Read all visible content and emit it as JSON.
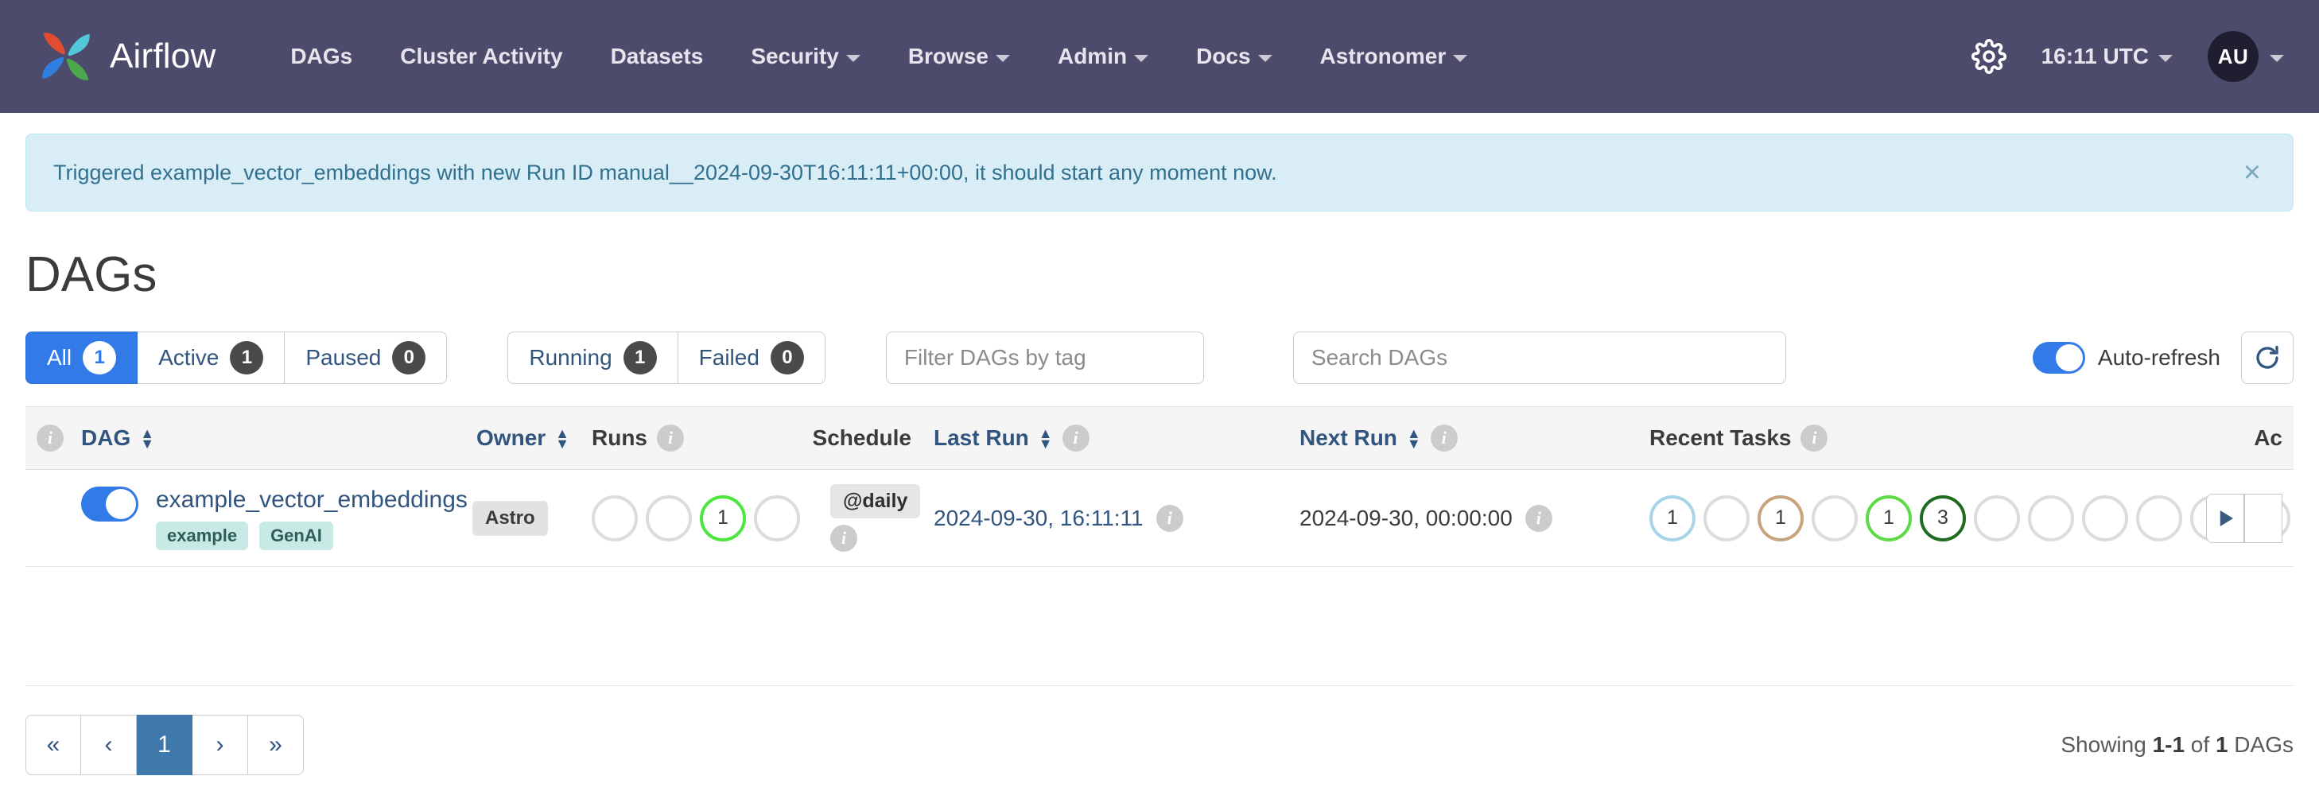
{
  "navbar": {
    "brand": "Airflow",
    "links": [
      {
        "label": "DAGs",
        "caret": false
      },
      {
        "label": "Cluster Activity",
        "caret": false
      },
      {
        "label": "Datasets",
        "caret": false
      },
      {
        "label": "Security",
        "caret": true
      },
      {
        "label": "Browse",
        "caret": true
      },
      {
        "label": "Admin",
        "caret": true
      },
      {
        "label": "Docs",
        "caret": true
      },
      {
        "label": "Astronomer",
        "caret": true
      }
    ],
    "settings_icon": "gear-icon",
    "clock": "16:11 UTC",
    "avatar_initials": "AU",
    "background_color": "#4d4b6c"
  },
  "alert": {
    "message": "Triggered example_vector_embeddings with new Run ID manual__2024-09-30T16:11:11+00:00, it should start any moment now.",
    "close_label": "×",
    "background_color": "#d9edf7",
    "text_color": "#31708f"
  },
  "page": {
    "title": "DAGs"
  },
  "filters": {
    "status_group": [
      {
        "label": "All",
        "count": "1",
        "active": true
      },
      {
        "label": "Active",
        "count": "1",
        "active": false
      },
      {
        "label": "Paused",
        "count": "0",
        "active": false
      }
    ],
    "state_group": [
      {
        "label": "Running",
        "count": "1",
        "active": false
      },
      {
        "label": "Failed",
        "count": "0",
        "active": false
      }
    ],
    "tag_filter_placeholder": "Filter DAGs by tag",
    "tag_filter_value": "",
    "search_placeholder": "Search DAGs",
    "search_value": "",
    "auto_refresh_label": "Auto-refresh",
    "auto_refresh_on": true,
    "refresh_icon": "refresh-icon",
    "accent_color": "#337ae9"
  },
  "table": {
    "headers": {
      "info": "",
      "dag": "DAG",
      "owner": "Owner",
      "runs": "Runs",
      "schedule": "Schedule",
      "last_run": "Last Run",
      "next_run": "Next Run",
      "recent_tasks": "Recent Tasks",
      "actions": "Ac"
    },
    "rows": [
      {
        "paused_toggle_on": true,
        "name": "example_vector_embeddings",
        "tags": [
          "example",
          "GenAI"
        ],
        "owner": "Astro",
        "runs": [
          {
            "count": "",
            "color": "#dcdcdc"
          },
          {
            "count": "",
            "color": "#dcdcdc"
          },
          {
            "count": "1",
            "color": "#4ce63f"
          },
          {
            "count": "",
            "color": "#dcdcdc"
          }
        ],
        "schedule": "@daily",
        "last_run": "2024-09-30, 16:11:11",
        "next_run": "2024-09-30, 00:00:00",
        "recent_tasks": [
          {
            "count": "1",
            "color": "#a8d4e8"
          },
          {
            "count": "",
            "color": "#dcdcdc"
          },
          {
            "count": "1",
            "color": "#c5a47e"
          },
          {
            "count": "",
            "color": "#dcdcdc"
          },
          {
            "count": "1",
            "color": "#5cdb45"
          },
          {
            "count": "3",
            "color": "#1f6b21"
          },
          {
            "count": "",
            "color": "#dcdcdc"
          },
          {
            "count": "",
            "color": "#dcdcdc"
          },
          {
            "count": "",
            "color": "#dcdcdc"
          },
          {
            "count": "",
            "color": "#dcdcdc"
          },
          {
            "count": "",
            "color": "#dcdcdc"
          },
          {
            "count": "",
            "color": "#dcdcdc"
          },
          {
            "count": "",
            "color": "#dcdcdc"
          },
          {
            "count": "",
            "color": "#dcdcdc"
          }
        ],
        "trigger_icon": "play-icon"
      }
    ]
  },
  "footer": {
    "pagination": [
      "«",
      "‹",
      "1",
      "›",
      "»"
    ],
    "current_page": "1",
    "showing_prefix": "Showing ",
    "showing_range": "1-1",
    "showing_middle": " of ",
    "showing_total": "1",
    "showing_suffix": " DAGs"
  }
}
